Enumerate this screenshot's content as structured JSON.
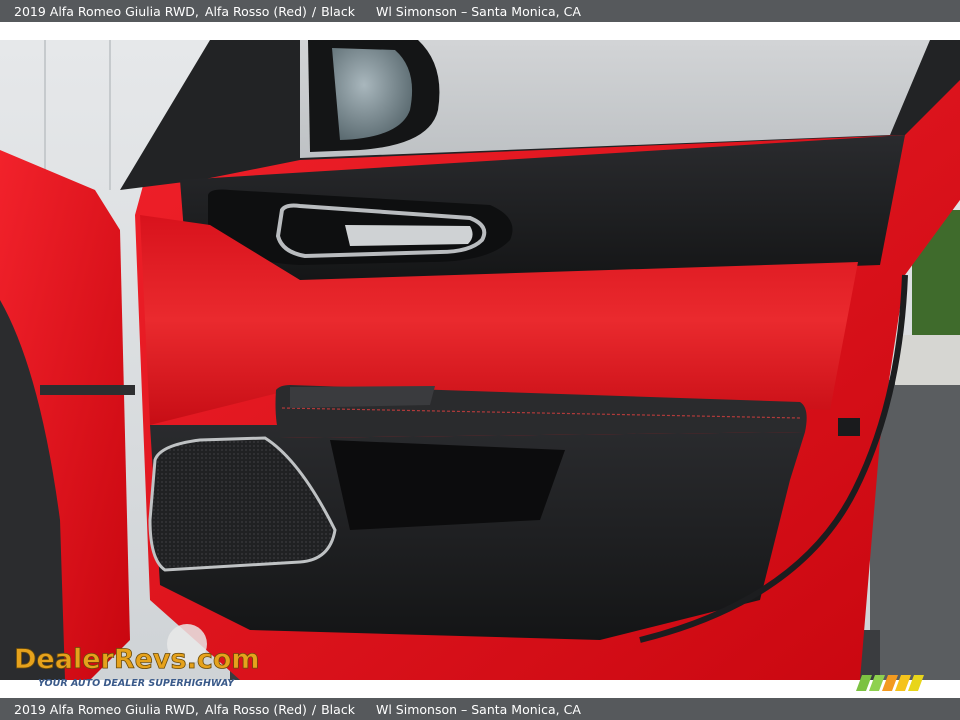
{
  "caption": {
    "vehicle": "2019 Alfa Romeo Giulia RWD,",
    "color": "Alfa Rosso (Red)",
    "separator": "/",
    "interior": "Black",
    "dealer": "Wl Simonson – Santa Monica, CA"
  },
  "watermark": {
    "brand": "DealerRevs.com",
    "tagline": "YOUR AUTO DEALER SUPERHIGHWAY"
  },
  "colors": {
    "caption_bar": "#56595c",
    "door_red": "#e8101b",
    "panel_black": "#1e1f21",
    "wall": "#dfe2e5"
  }
}
